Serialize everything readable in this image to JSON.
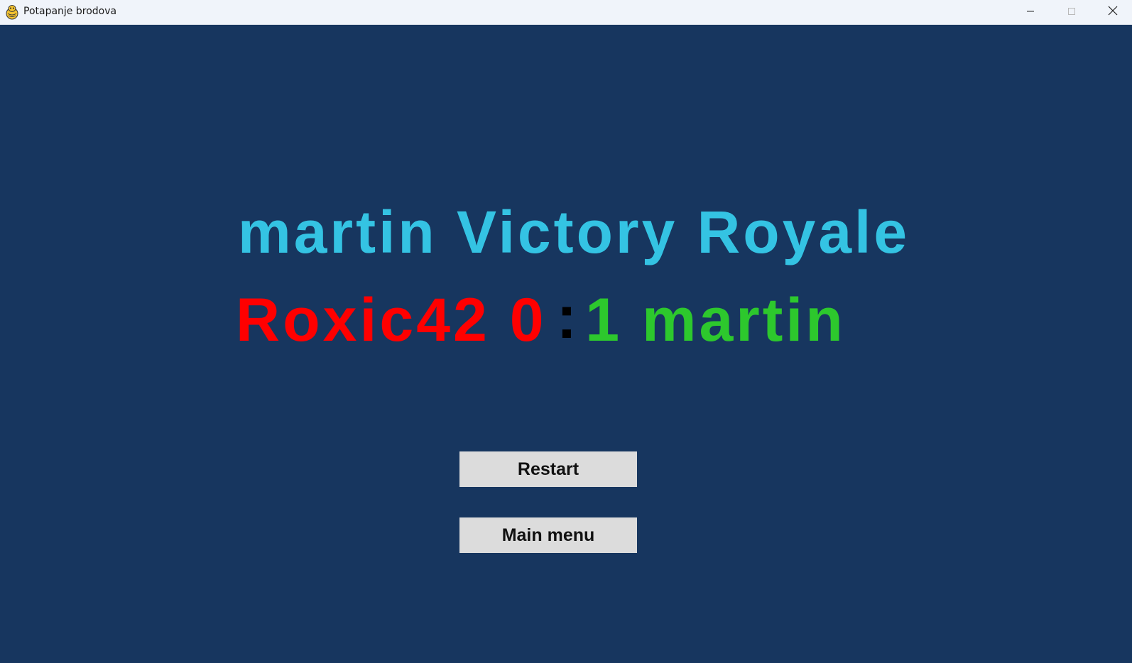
{
  "window": {
    "title": "Potapanje brodova",
    "app_icon": "pygame-snake-icon",
    "controls": {
      "minimize_icon": "minimize-icon",
      "maximize_icon": "maximize-icon",
      "close_icon": "close-icon"
    }
  },
  "game_over": {
    "victory_text": "martin Victory Royale",
    "score": {
      "loser_name": "Roxic42",
      "loser_score": "0",
      "separator": ":",
      "winner_score": "1",
      "winner_name": "martin"
    },
    "buttons": {
      "restart_label": "Restart",
      "main_menu_label": "Main menu"
    }
  },
  "colors": {
    "background": "#17365f",
    "victory_text": "#34c3e3",
    "loser": "#ff0000",
    "winner": "#2dc82d",
    "separator": "#000000",
    "button_bg": "#dcdcdc",
    "titlebar_bg": "#f0f4fa"
  }
}
